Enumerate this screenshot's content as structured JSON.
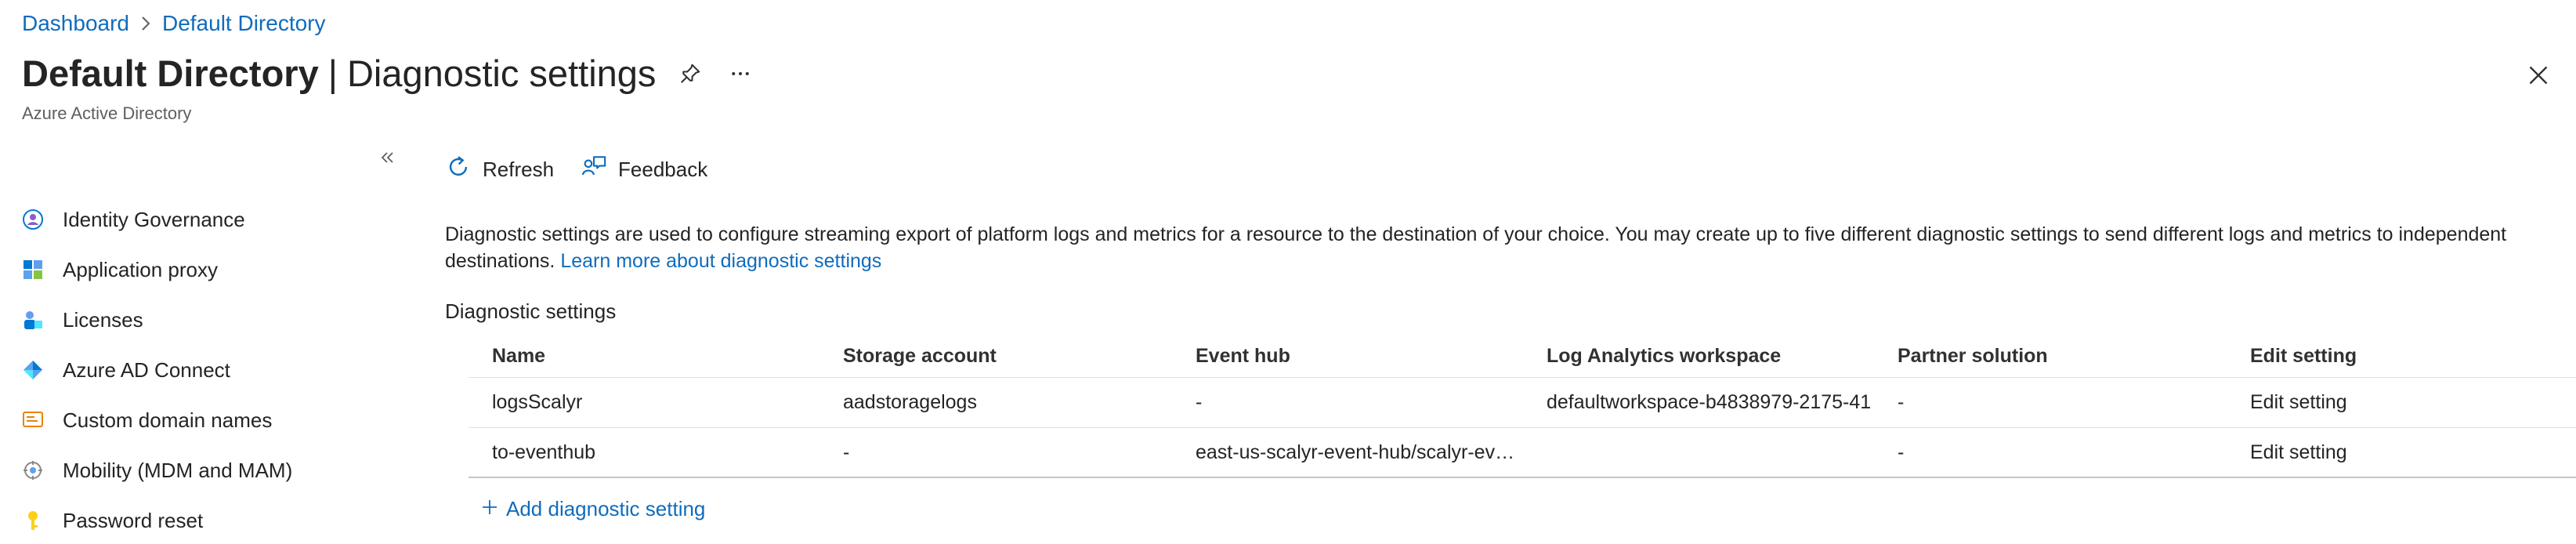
{
  "breadcrumb": {
    "items": [
      "Dashboard",
      "Default Directory"
    ]
  },
  "header": {
    "title_strong": "Default Directory",
    "title_divider": "|",
    "title_rest": "Diagnostic settings",
    "subtitle": "Azure Active Directory"
  },
  "sidebar": {
    "items": [
      {
        "label": "Identity Governance",
        "icon": "identity-governance-icon"
      },
      {
        "label": "Application proxy",
        "icon": "application-proxy-icon"
      },
      {
        "label": "Licenses",
        "icon": "licenses-icon"
      },
      {
        "label": "Azure AD Connect",
        "icon": "azure-ad-connect-icon"
      },
      {
        "label": "Custom domain names",
        "icon": "custom-domain-icon"
      },
      {
        "label": "Mobility (MDM and MAM)",
        "icon": "mobility-icon"
      },
      {
        "label": "Password reset",
        "icon": "key-icon"
      }
    ]
  },
  "toolbar": {
    "refresh_label": "Refresh",
    "feedback_label": "Feedback"
  },
  "main": {
    "description": "Diagnostic settings are used to configure streaming export of platform logs and metrics for a resource to the destination of your choice. You may create up to five different diagnostic settings to send different logs and metrics to independent destinations.",
    "learn_more": "Learn more about diagnostic settings",
    "section_label": "Diagnostic settings",
    "add_label": "Add diagnostic setting"
  },
  "table": {
    "columns": [
      "Name",
      "Storage account",
      "Event hub",
      "Log Analytics workspace",
      "Partner solution",
      "Edit setting"
    ],
    "rows": [
      [
        "logsScalyr",
        "aadstoragelogs",
        "-",
        "defaultworkspace-b4838979-2175-41",
        "-",
        "Edit setting"
      ],
      [
        "to-eventhub",
        "-",
        "east-us-scalyr-event-hub/scalyr-ev…",
        "",
        "-",
        "Edit setting"
      ]
    ]
  },
  "colors": {
    "link": "#0f6cbd",
    "text": "#242424",
    "muted": "#605e5c"
  }
}
